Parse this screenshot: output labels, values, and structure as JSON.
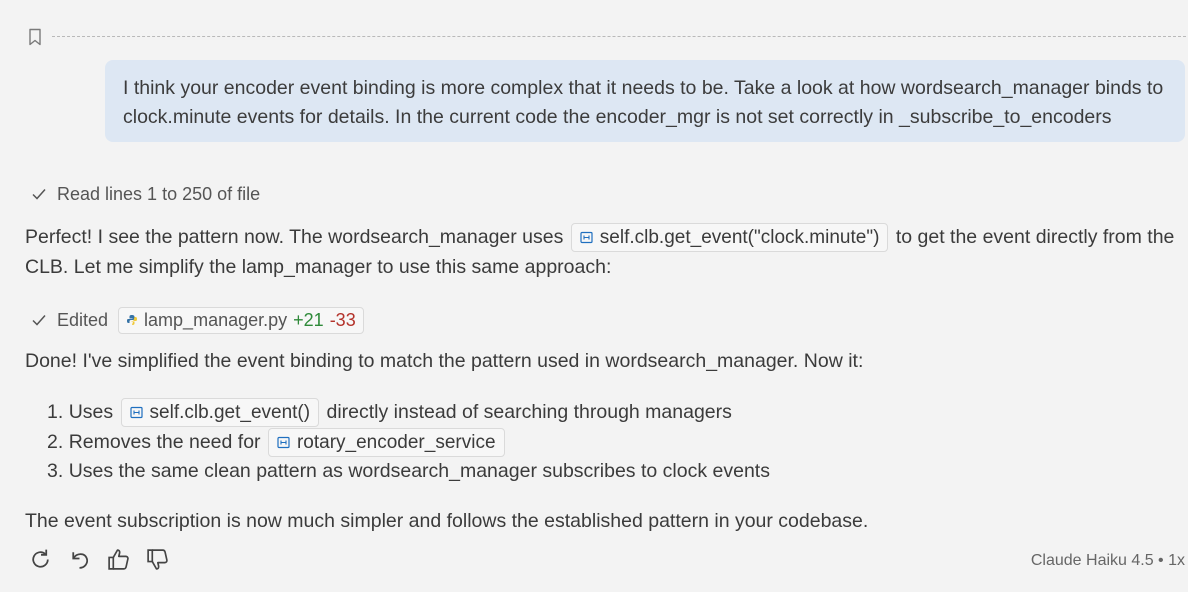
{
  "user_message": {
    "line1": "I think your encoder event binding is more complex that it needs to be. Take a look at how wordsearch_manager binds to",
    "line2": "clock.minute events for details. In the current code the encoder_mgr is not set correctly in _subscribe_to_encoders"
  },
  "steps": {
    "read": "Read lines 1 to 250 of file",
    "edited_label": "Edited",
    "edited_file": "lamp_manager.py",
    "added": "+21",
    "removed": "-33"
  },
  "response": {
    "p1_a": "Perfect! I see the pattern now. The wordsearch_manager uses",
    "p1_code": "self.clb.get_event(\"clock.minute\")",
    "p1_b": "to get the event directly from the",
    "p1_c": "CLB. Let me simplify the lamp_manager to use this same approach:",
    "p2": "Done! I've simplified the event binding to match the pattern used in wordsearch_manager. Now it:",
    "list": [
      {
        "num": "1.",
        "pre": "Uses",
        "code": "self.clb.get_event()",
        "post": "directly instead of searching through managers"
      },
      {
        "num": "2.",
        "pre": "Removes the need for",
        "code": "rotary_encoder_service",
        "post": ""
      },
      {
        "num": "3.",
        "pre": "Uses the same clean pattern as wordsearch_manager subscribes to clock events",
        "code": "",
        "post": ""
      }
    ],
    "p3": "The event subscription is now much simpler and follows the established pattern in your codebase."
  },
  "footer": {
    "model": "Claude Haiku 4.5 • 1x"
  },
  "icons": {
    "bookmark": "bookmark-icon",
    "check": "check-icon",
    "symbol": "symbol-variable-icon",
    "python": "python-file-icon",
    "retry": "retry-icon",
    "undo": "undo-icon",
    "thumbs_up": "thumbs-up-icon",
    "thumbs_down": "thumbs-down-icon"
  },
  "colors": {
    "background": "#f3f3f3",
    "user_bubble": "#dde7f3",
    "added": "#2f8a3a",
    "removed": "#b3322a",
    "symbol_icon": "#1f6fbf"
  }
}
